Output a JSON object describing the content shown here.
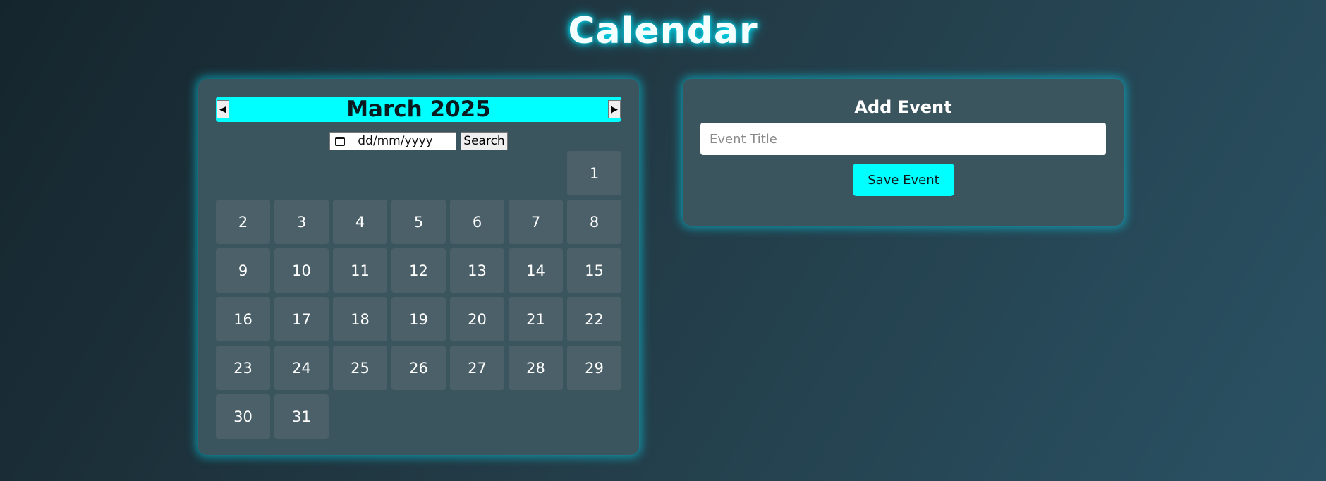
{
  "page": {
    "title": "Calendar"
  },
  "calendar": {
    "month_label": "March 2025",
    "prev_label": "◀",
    "next_label": "▶",
    "search": {
      "date_placeholder": "dd/mm/yyyy",
      "button_label": "Search"
    },
    "leading_blanks": 6,
    "days": [
      "1",
      "2",
      "3",
      "4",
      "5",
      "6",
      "7",
      "8",
      "9",
      "10",
      "11",
      "12",
      "13",
      "14",
      "15",
      "16",
      "17",
      "18",
      "19",
      "20",
      "21",
      "22",
      "23",
      "24",
      "25",
      "26",
      "27",
      "28",
      "29",
      "30",
      "31"
    ]
  },
  "event_form": {
    "heading": "Add Event",
    "title_placeholder": "Event Title",
    "save_label": "Save Event"
  },
  "colors": {
    "accent": "#00ffff",
    "panel": "#3b555f",
    "day_cell": "#4b6068"
  }
}
